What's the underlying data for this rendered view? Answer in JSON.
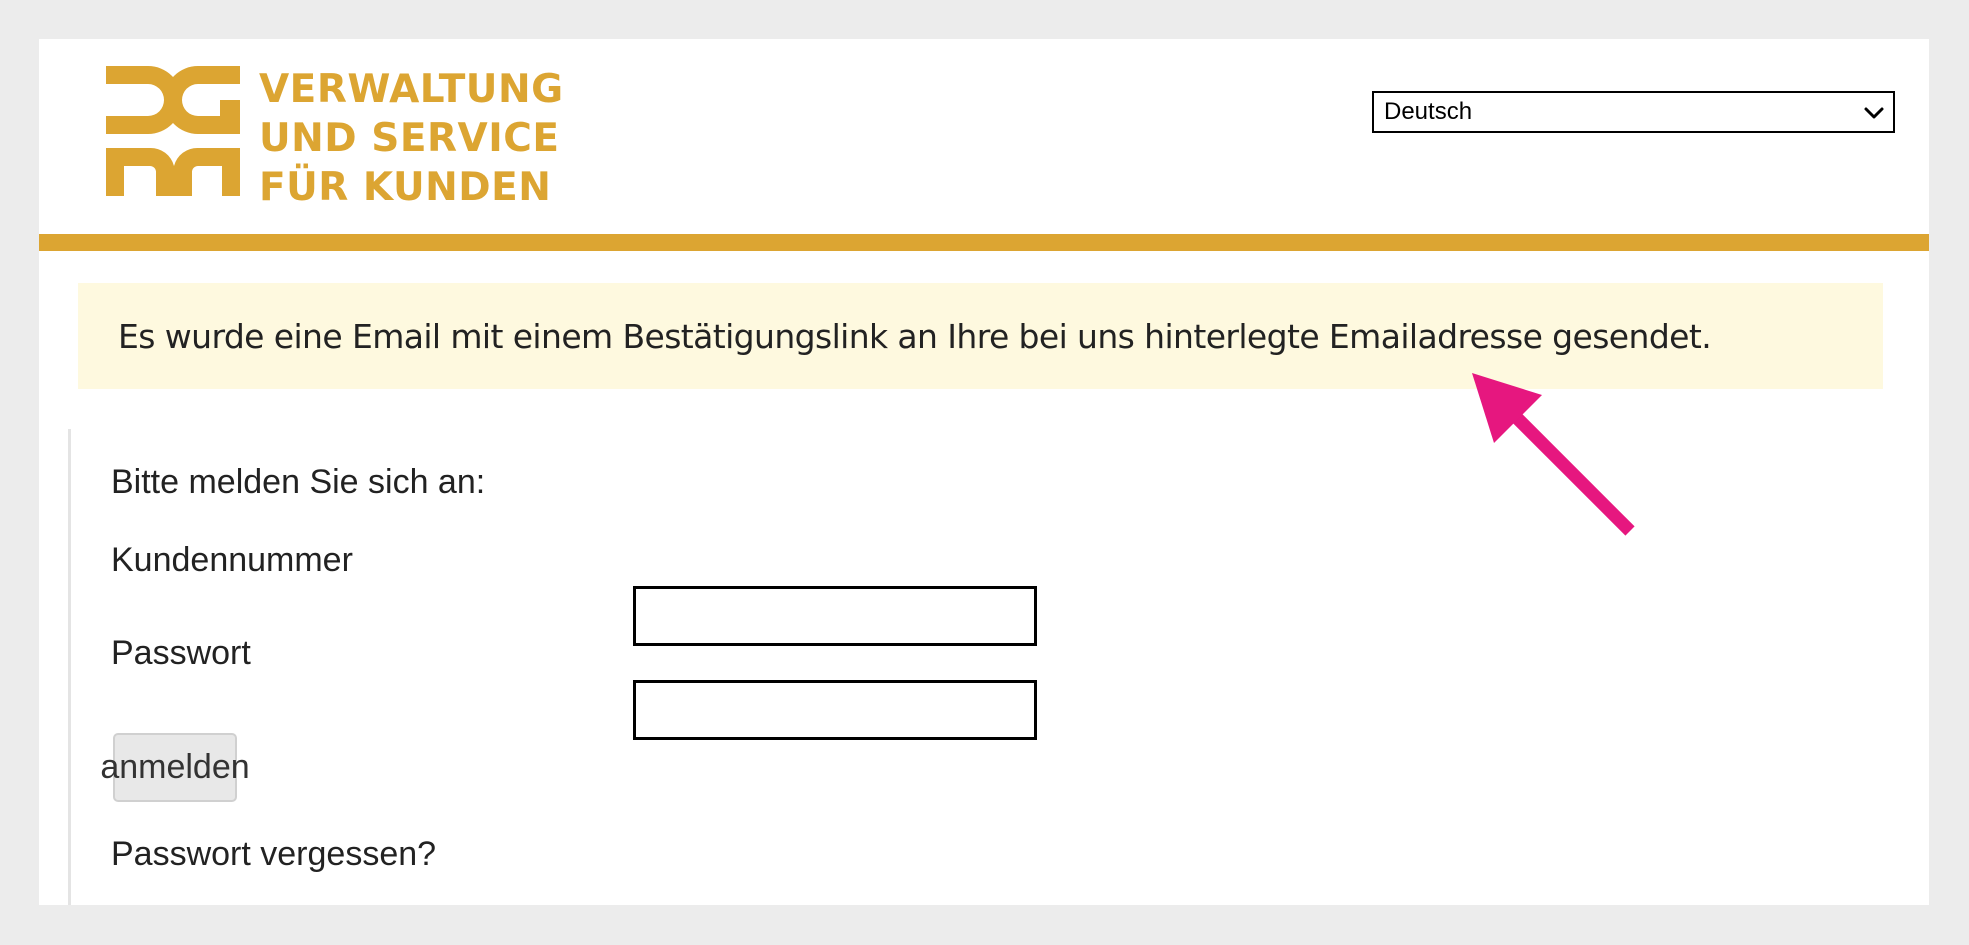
{
  "logo": {
    "lines": [
      "VERWALTUNG",
      "UND SERVICE",
      "FÜR KUNDEN"
    ]
  },
  "language_select": {
    "value": "Deutsch",
    "icon": "chevron-down-icon"
  },
  "notice": {
    "text": "Es wurde eine Email mit einem Bestätigungslink an Ihre bei uns hinterlegte Emailadresse gesendet."
  },
  "login": {
    "title": "Bitte melden Sie sich an:",
    "customer_number_label": "Kundennummer",
    "password_label": "Passwort",
    "submit_label": "anmelden",
    "forgot_label": "Passwort vergessen?"
  },
  "colors": {
    "brand": "#dca532",
    "notice_bg": "#fef9df",
    "arrow": "#e6177f"
  }
}
